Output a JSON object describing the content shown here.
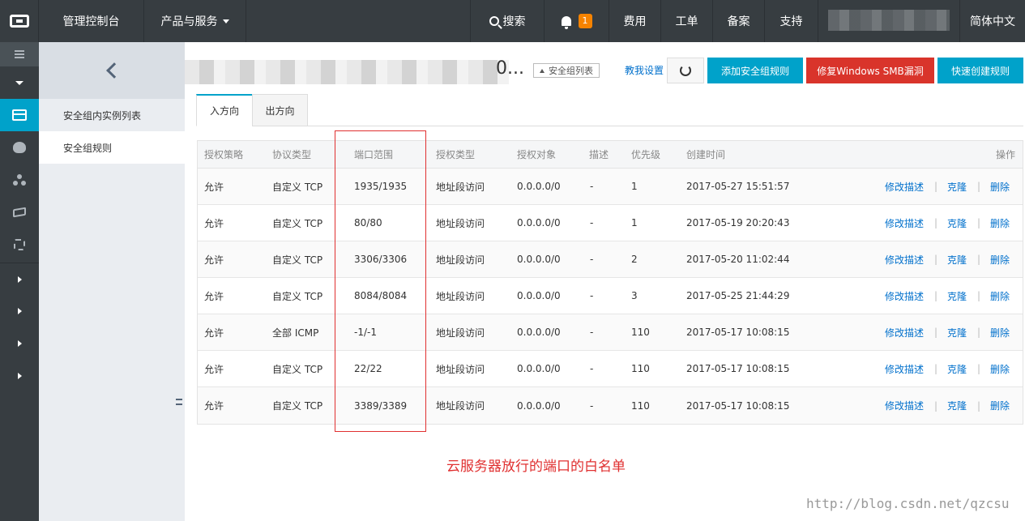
{
  "topbar": {
    "console": "管理控制台",
    "products": "产品与服务",
    "search": "搜索",
    "notifications_count": "1",
    "billing": "费用",
    "tickets": "工单",
    "icp": "备案",
    "support": "支持",
    "language": "简体中文"
  },
  "secondary_nav": {
    "items": [
      {
        "label": "安全组内实例列表"
      },
      {
        "label": "安全组规则"
      }
    ]
  },
  "header": {
    "title_tail": "0...",
    "back_to_list": "安全组列表",
    "teach_me": "教我设置",
    "add_rule": "添加安全组规则",
    "fix_smb": "修复Windows SMB漏洞",
    "quick_create": "快速创建规则"
  },
  "tabs": [
    {
      "label": "入方向"
    },
    {
      "label": "出方向"
    }
  ],
  "table": {
    "headers": [
      "授权策略",
      "协议类型",
      "端口范围",
      "授权类型",
      "授权对象",
      "描述",
      "优先级",
      "创建时间",
      "操作"
    ],
    "rows": [
      {
        "policy": "允许",
        "protocol": "自定义 TCP",
        "port": "1935/1935",
        "auth_type": "地址段访问",
        "object": "0.0.0.0/0",
        "desc": "-",
        "priority": "1",
        "created": "2017-05-27 15:51:57"
      },
      {
        "policy": "允许",
        "protocol": "自定义 TCP",
        "port": "80/80",
        "auth_type": "地址段访问",
        "object": "0.0.0.0/0",
        "desc": "-",
        "priority": "1",
        "created": "2017-05-19 20:20:43"
      },
      {
        "policy": "允许",
        "protocol": "自定义 TCP",
        "port": "3306/3306",
        "auth_type": "地址段访问",
        "object": "0.0.0.0/0",
        "desc": "-",
        "priority": "2",
        "created": "2017-05-20 11:02:44"
      },
      {
        "policy": "允许",
        "protocol": "自定义 TCP",
        "port": "8084/8084",
        "auth_type": "地址段访问",
        "object": "0.0.0.0/0",
        "desc": "-",
        "priority": "3",
        "created": "2017-05-25 21:44:29"
      },
      {
        "policy": "允许",
        "protocol": "全部 ICMP",
        "port": "-1/-1",
        "auth_type": "地址段访问",
        "object": "0.0.0.0/0",
        "desc": "-",
        "priority": "110",
        "created": "2017-05-17 10:08:15"
      },
      {
        "policy": "允许",
        "protocol": "自定义 TCP",
        "port": "22/22",
        "auth_type": "地址段访问",
        "object": "0.0.0.0/0",
        "desc": "-",
        "priority": "110",
        "created": "2017-05-17 10:08:15"
      },
      {
        "policy": "允许",
        "protocol": "自定义 TCP",
        "port": "3389/3389",
        "auth_type": "地址段访问",
        "object": "0.0.0.0/0",
        "desc": "-",
        "priority": "110",
        "created": "2017-05-17 10:08:15"
      }
    ],
    "actions": {
      "edit_desc": "修改描述",
      "clone": "克隆",
      "delete": "删除",
      "separator": "|"
    }
  },
  "annotation": "云服务器放行的端口的白名单",
  "watermark": "http://blog.csdn.net/qzcsu",
  "colors": {
    "topbar": "#373d41",
    "accent": "#00a2ca",
    "danger": "#d9342b",
    "annotation": "#e03030",
    "link": "#0070cc"
  }
}
